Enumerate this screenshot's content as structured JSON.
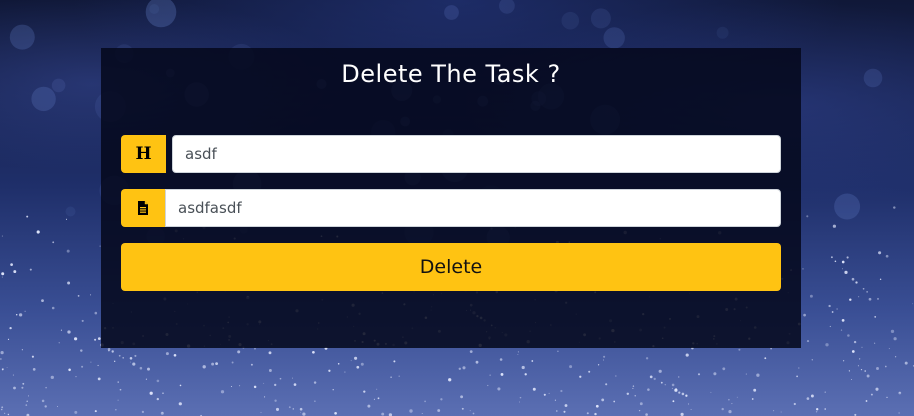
{
  "page": {
    "title": "Delete The Task ?"
  },
  "form": {
    "heading_icon": "heading-icon",
    "heading_glyph": "H",
    "heading_value": "asdf",
    "description_icon": "document-icon",
    "description_value": "asdfasdf",
    "submit_label": "Delete"
  },
  "colors": {
    "accent": "#ffc312",
    "panel": "#05081c"
  }
}
